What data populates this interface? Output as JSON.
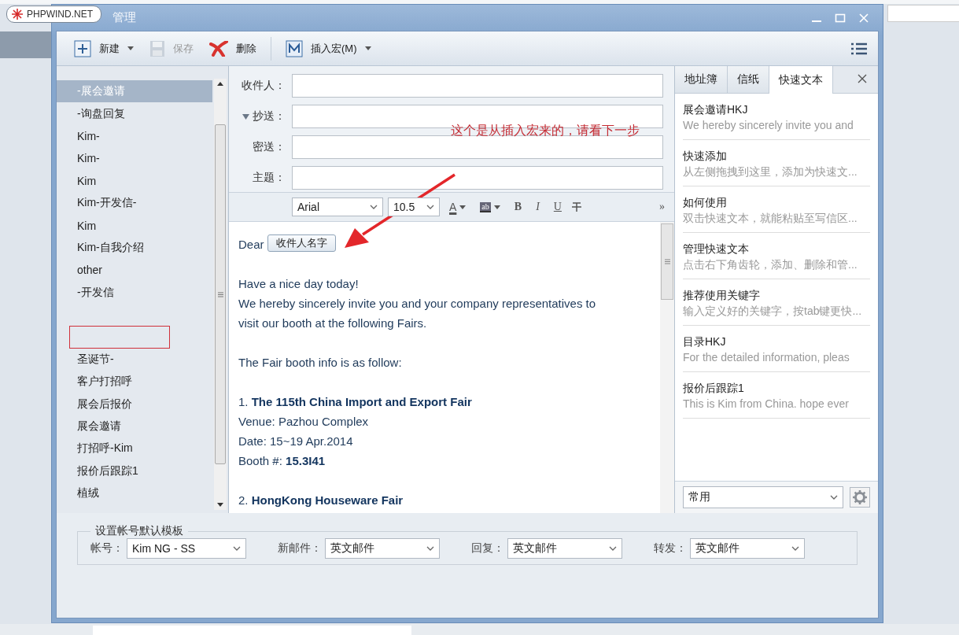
{
  "desktop": {
    "logo": "PHPWIND.NET"
  },
  "window": {
    "title": "管理"
  },
  "toolbar": {
    "buttons": [
      {
        "label": "新建",
        "kind": "new",
        "disabled": false,
        "dropdown": true
      },
      {
        "label": "保存",
        "kind": "save",
        "disabled": true,
        "dropdown": false
      },
      {
        "label": "删除",
        "kind": "delete",
        "disabled": false,
        "dropdown": false
      },
      {
        "label": "插入宏(M)",
        "kind": "macro",
        "disabled": false,
        "dropdown": true
      }
    ]
  },
  "templates": {
    "items": [
      {
        "label": "-展会邀请",
        "selected": true,
        "outlined": false
      },
      {
        "label": "-询盘回复",
        "selected": false,
        "outlined": false
      },
      {
        "label": "Kim-",
        "selected": false,
        "outlined": false
      },
      {
        "label": "Kim-",
        "selected": false,
        "outlined": false
      },
      {
        "label": "Kim",
        "selected": false,
        "outlined": false
      },
      {
        "label": "Kim-开发信-",
        "selected": false,
        "outlined": false
      },
      {
        "label": "Kim",
        "selected": false,
        "outlined": false
      },
      {
        "label": "Kim-自我介绍",
        "selected": false,
        "outlined": false
      },
      {
        "label": "other",
        "selected": false,
        "outlined": false
      },
      {
        "label": "-开发信",
        "selected": false,
        "outlined": false
      },
      {
        "selected": false,
        "outlined": false
      },
      {
        "selected": false,
        "outlined": true
      },
      {
        "label": "圣诞节-",
        "selected": false,
        "outlined": false
      },
      {
        "label": "客户打招呼",
        "selected": false,
        "outlined": false
      },
      {
        "label": "展会后报价",
        "selected": false,
        "outlined": false
      },
      {
        "label": "展会邀请",
        "selected": false,
        "outlined": false
      },
      {
        "label": "打招呼-Kim",
        "selected": false,
        "outlined": false
      },
      {
        "label": "报价后跟踪1",
        "selected": false,
        "outlined": false
      },
      {
        "label": "植绒",
        "selected": false,
        "outlined": false
      }
    ]
  },
  "compose": {
    "fields": [
      {
        "label": "收件人：",
        "kind": "plain"
      },
      {
        "label": "抄送：",
        "kind": "toggle",
        "expanded": true
      },
      {
        "label": "密送：",
        "kind": "plain"
      },
      {
        "label": "主题：",
        "kind": "plain"
      }
    ],
    "annotation": "这个是从插入宏来的，请看下一步",
    "format_bar": {
      "font": "Arial",
      "size": "10.5",
      "font_color": "A",
      "highlight": "ab",
      "bold": "B",
      "italic": "I",
      "underline": "U",
      "more": "»"
    },
    "body": {
      "greeting": "Dear",
      "macro": "收件人名字",
      "paragraphs": [
        [
          "Have a nice day today!",
          "We hereby sincerely invite you and your company representatives to",
          "visit our booth at the following Fairs."
        ],
        [
          "The Fair booth info is as follow:"
        ],
        [
          "1. **The 115th China Import and Export Fair**",
          "Venue: Pazhou Complex",
          "Date: 15~19 Apr.2014",
          "Booth #: **15.3I41**"
        ],
        [
          "2. **HongKong Houseware Fair**"
        ]
      ]
    }
  },
  "quick_panel": {
    "tabs": [
      {
        "label": "地址簿",
        "selected": false
      },
      {
        "label": "信纸",
        "selected": false
      },
      {
        "label": "快速文本",
        "selected": true
      }
    ],
    "snippets": [
      {
        "title": "展会邀请HKJ",
        "preview": "We hereby sincerely invite you and"
      },
      {
        "title": "快速添加",
        "preview": "从左侧拖拽到这里，添加为快速文..."
      },
      {
        "title": "如何使用",
        "preview": "双击快速文本，就能粘贴至写信区..."
      },
      {
        "title": "管理快速文本",
        "preview": "点击右下角齿轮，添加、删除和管..."
      },
      {
        "title": "推荐使用关键字",
        "preview": "输入定义好的关键字，按tab键更快..."
      },
      {
        "title": "目录HKJ",
        "preview": "For the detailed information, pleas"
      },
      {
        "title": "报价后跟踪1",
        "preview": "This is Kim from China. hope ever"
      }
    ],
    "category": "常用"
  },
  "defaults": {
    "legend": "设置帐号默认模板",
    "fields": [
      {
        "label": "帐号：",
        "value": "Kim NG - SS"
      },
      {
        "label": "新邮件：",
        "value": "英文邮件"
      },
      {
        "label": "回复：",
        "value": "英文邮件"
      },
      {
        "label": "转发：",
        "value": "英文邮件"
      }
    ]
  }
}
